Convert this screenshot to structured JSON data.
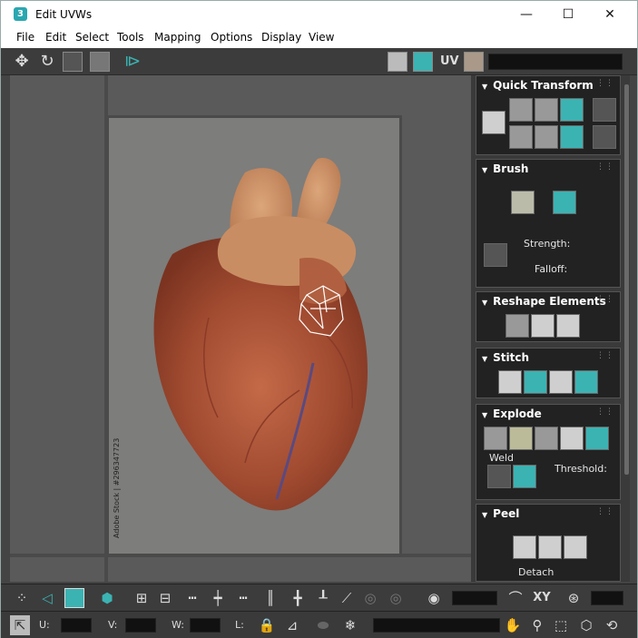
{
  "window": {
    "title": "Edit UVWs",
    "app_icon": "3",
    "controls": {
      "minimize": "—",
      "maximize": "☐",
      "close": "✕"
    }
  },
  "menu": {
    "items": [
      "File",
      "Edit",
      "Select",
      "Tools",
      "Mapping",
      "Options",
      "Display",
      "View"
    ]
  },
  "top_toolbar": {
    "uv_label": "UV"
  },
  "viewport": {
    "stock_text": "Adobe Stock | #296347723"
  },
  "panel": {
    "quick_transform": {
      "title": "Quick Transform"
    },
    "brush": {
      "title": "Brush",
      "strength_label": "Strength:",
      "falloff_label": "Falloff:"
    },
    "reshape": {
      "title": "Reshape Elements"
    },
    "stitch": {
      "title": "Stitch"
    },
    "explode": {
      "title": "Explode",
      "weld_label": "Weld",
      "threshold_label": "Threshold:"
    },
    "peel": {
      "title": "Peel",
      "detach_label": "Detach"
    }
  },
  "bottom_toolbar": {
    "xy_label": "XY"
  },
  "status_bar": {
    "u_label": "U:",
    "v_label": "V:",
    "w_label": "W:",
    "l_label": "L:"
  },
  "colors": {
    "accent_teal": "#3bb3b3",
    "panel_bg": "#3a3a3a",
    "viewport_bg": "#5a5a5a"
  }
}
